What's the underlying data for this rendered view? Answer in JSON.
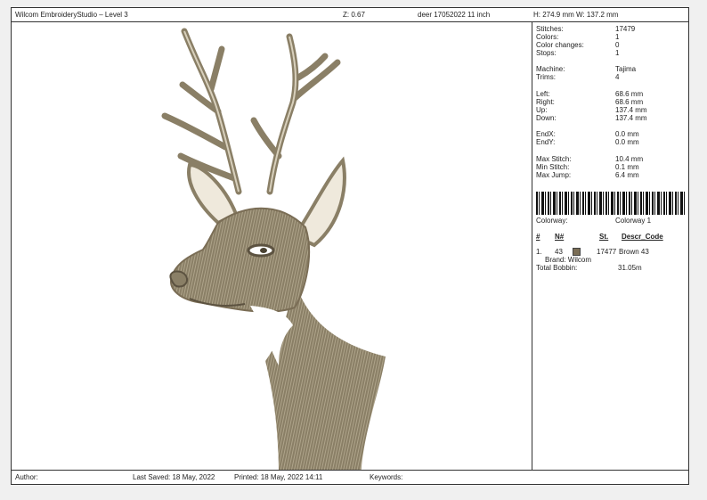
{
  "header": {
    "app_title": "Wilcom EmbroideryStudio – Level 3",
    "zoom": "Z: 0.67",
    "design_name": "deer 17052022 11 inch",
    "dimensions": "H: 274.9 mm   W: 137.2 mm"
  },
  "stats": {
    "stitches_label": "Stitches:",
    "stitches": "17479",
    "colors_label": "Colors:",
    "colors": "1",
    "color_changes_label": "Color changes:",
    "color_changes": "0",
    "stops_label": "Stops:",
    "stops": "1",
    "machine_label": "Machine:",
    "machine": "Tajima",
    "trims_label": "Trims:",
    "trims": "4",
    "left_label": "Left:",
    "left": "68.6 mm",
    "right_label": "Right:",
    "right": "68.6 mm",
    "up_label": "Up:",
    "up": "137.4 mm",
    "down_label": "Down:",
    "down": "137.4 mm",
    "endx_label": "EndX:",
    "endx": "0.0 mm",
    "endy_label": "EndY:",
    "endy": "0.0 mm",
    "max_stitch_label": "Max Stitch:",
    "max_stitch": "10.4 mm",
    "min_stitch_label": "Min Stitch:",
    "min_stitch": "0.1 mm",
    "max_jump_label": "Max Jump:",
    "max_jump": "6.4 mm"
  },
  "colorway": {
    "label": "Colorway:",
    "value": "Colorway 1",
    "headers": [
      "#",
      "N#",
      "St.",
      "Descr_Code"
    ],
    "rows": [
      {
        "index": "1.",
        "code": "43",
        "swatch_color": "#7a6d55",
        "stitches": "17477",
        "descr": "Brown 43",
        "brand": "Brand: Wilcom"
      }
    ],
    "total_bobbin_label": "Total Bobbin:",
    "total_bobbin": "31.05m"
  },
  "footer": {
    "author": "Author:",
    "last_saved": "Last Saved: 18 May, 2022",
    "printed": "Printed: 18 May, 2022 14:11",
    "keywords": "Keywords:"
  }
}
